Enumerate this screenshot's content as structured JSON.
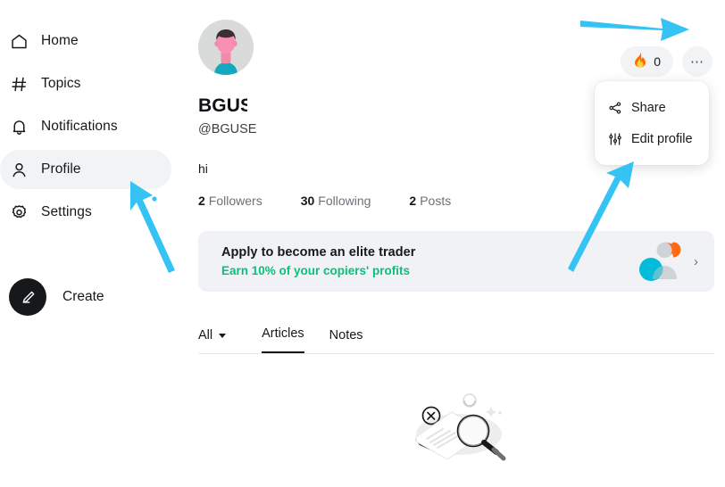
{
  "sidebar": {
    "items": [
      {
        "label": "Home",
        "icon": "home-icon",
        "active": false
      },
      {
        "label": "Topics",
        "icon": "hash-icon",
        "active": false
      },
      {
        "label": "Notifications",
        "icon": "bell-icon",
        "active": false
      },
      {
        "label": "Profile",
        "icon": "person-icon",
        "active": true
      },
      {
        "label": "Settings",
        "icon": "gear-icon",
        "active": false
      }
    ],
    "create_label": "Create",
    "create_icon": "pencil-icon"
  },
  "profile": {
    "avatar_icon": "user-avatar",
    "display_name": "BGUSI",
    "handle": "@BGUSE",
    "bio": "hi",
    "stats": [
      {
        "value": "2",
        "label": "Followers"
      },
      {
        "value": "30",
        "label": "Following"
      },
      {
        "value": "2",
        "label": "Posts"
      }
    ]
  },
  "top_controls": {
    "flame_icon": "flame-icon",
    "flame_count": "0",
    "more_icon": "ellipsis-icon"
  },
  "dropdown": {
    "items": [
      {
        "label": "Share",
        "icon": "share-nodes-icon"
      },
      {
        "label": "Edit profile",
        "icon": "sliders-icon"
      }
    ]
  },
  "promo": {
    "title": "Apply to become an elite trader",
    "subtitle": "Earn 10% of your copiers' profits",
    "chevron_icon": "chevron-right-icon",
    "art_icon": "copy-traders-illustration"
  },
  "tabs": [
    {
      "label": "All",
      "type": "filter",
      "has_caret": true,
      "selected": false
    },
    {
      "label": "Articles",
      "type": "tab",
      "has_caret": false,
      "selected": true
    },
    {
      "label": "Notes",
      "type": "tab",
      "has_caret": false,
      "selected": false
    }
  ],
  "empty_state": {
    "illustration_icon": "no-results-document-magnifier-illustration"
  },
  "annotations": {
    "arrow_color": "#35c3f3",
    "arrows": [
      {
        "name": "arrow-to-more-menu",
        "points_to": "more-button"
      },
      {
        "name": "arrow-to-profile-nav",
        "points_to": "sidebar-item-profile"
      },
      {
        "name": "arrow-to-edit-profile",
        "points_to": "dropdown-item-edit-profile"
      }
    ]
  },
  "colors": {
    "accent_green": "#0bbf78",
    "arrow_cyan": "#35c3f3",
    "surface_gray": "#f2f3f5",
    "banner_gray": "#f1f2f6",
    "text_primary": "#16181c",
    "text_muted": "#6b7177",
    "avatar_hair": "#3b2f33",
    "avatar_skin": "#f98bb0",
    "avatar_shirt": "#14a8bf",
    "create_bg": "#17181a"
  }
}
